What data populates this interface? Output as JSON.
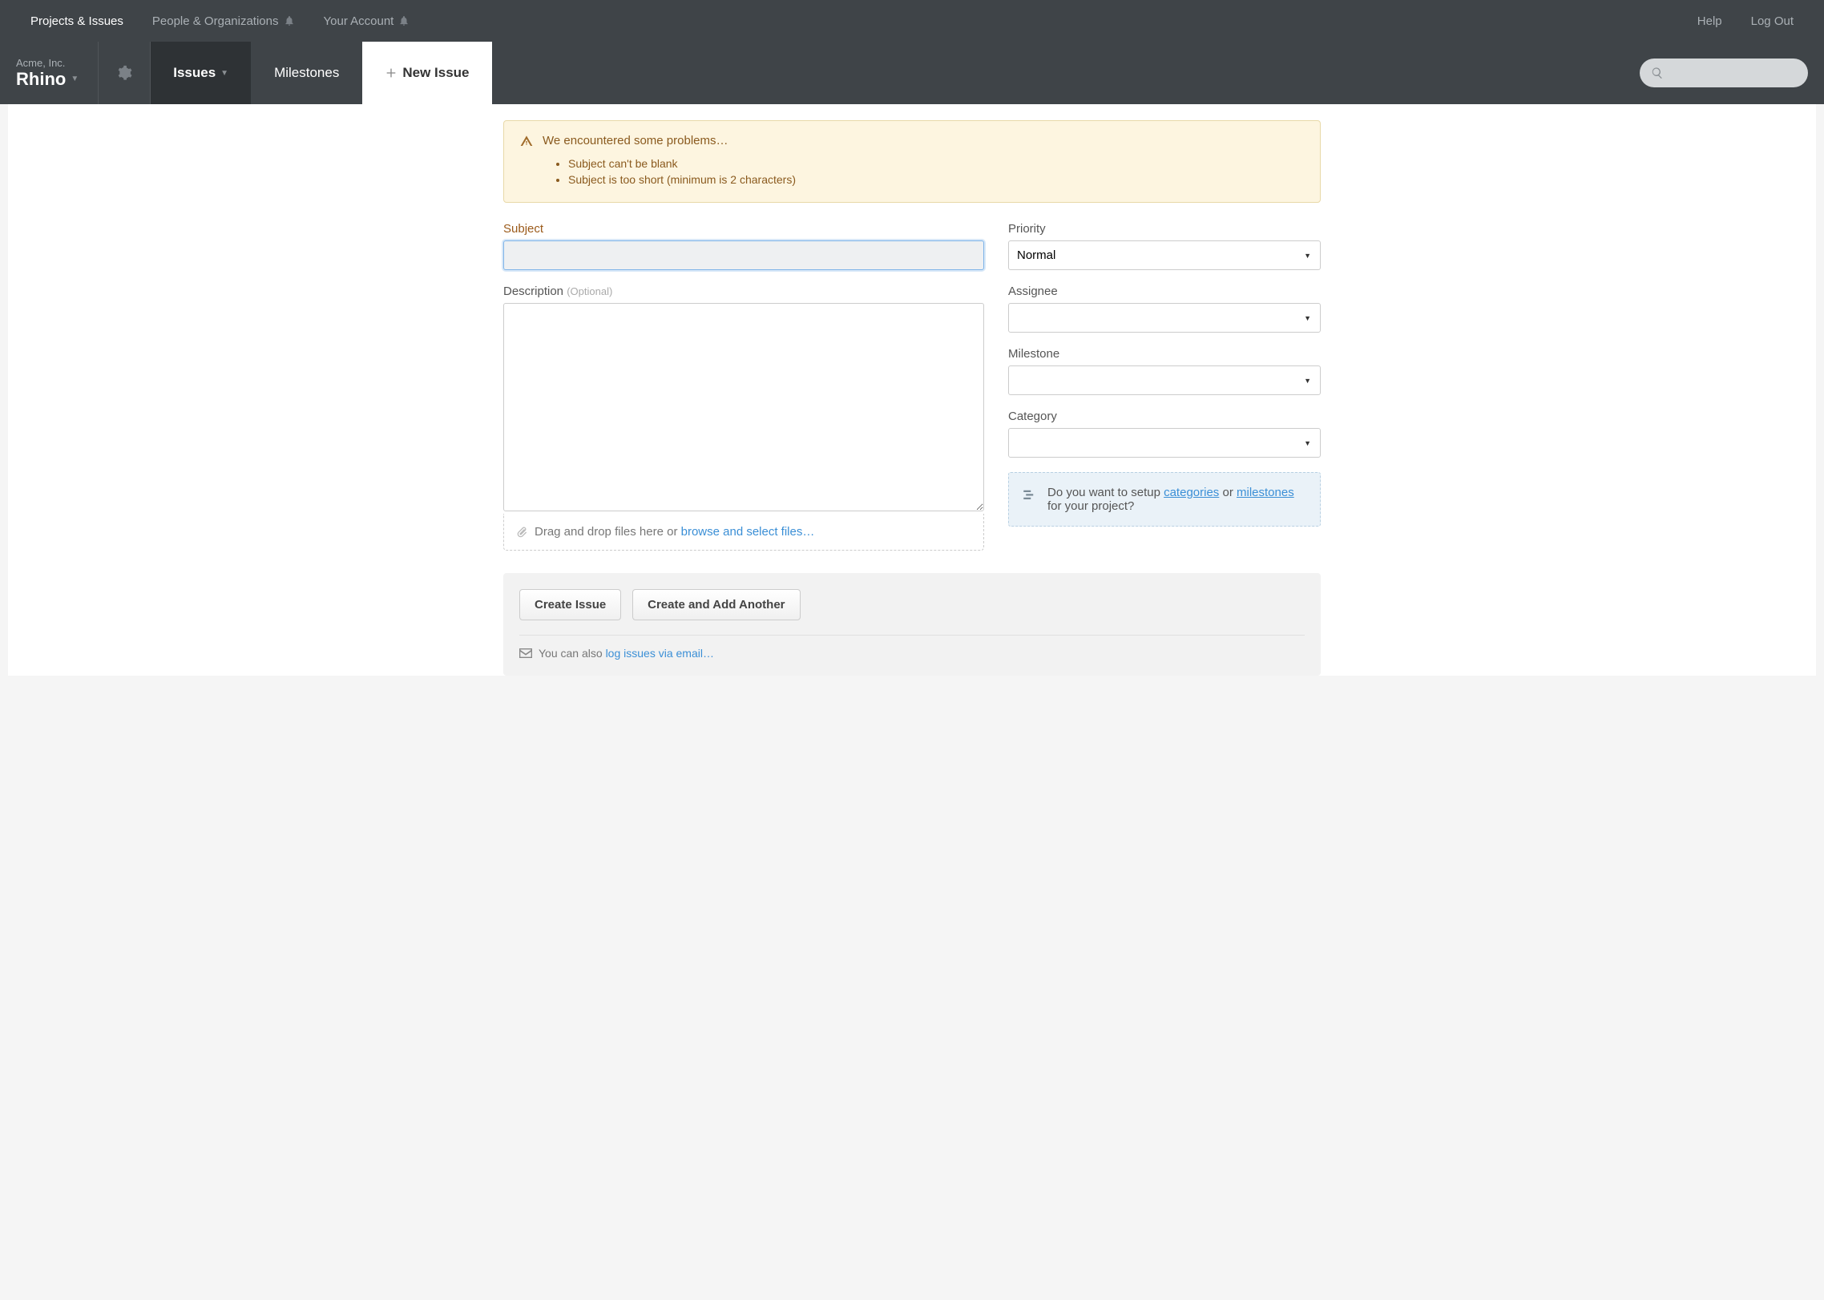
{
  "topnav": {
    "projects": "Projects & Issues",
    "people": "People & Organizations",
    "account": "Your Account",
    "help": "Help",
    "logout": "Log Out"
  },
  "subnav": {
    "org": "Acme, Inc.",
    "project": "Rhino",
    "issues": "Issues",
    "milestones": "Milestones",
    "newIssue": "New Issue"
  },
  "alert": {
    "title": "We encountered some problems…",
    "errors": [
      "Subject can't be blank",
      "Subject is too short (minimum is 2 characters)"
    ]
  },
  "form": {
    "subjectLabel": "Subject",
    "subjectValue": "",
    "descriptionLabel": "Description",
    "descriptionOptional": "(Optional)",
    "descriptionValue": "",
    "priorityLabel": "Priority",
    "priorityValue": "Normal",
    "assigneeLabel": "Assignee",
    "assigneeValue": "",
    "milestoneLabel": "Milestone",
    "milestoneValue": "",
    "categoryLabel": "Category",
    "categoryValue": ""
  },
  "dragzone": {
    "prefix": "Drag and drop files here or ",
    "link": "browse and select files…"
  },
  "infobox": {
    "prefix": "Do you want to setup ",
    "link1": "categories",
    "middle": " or ",
    "link2": "milestones",
    "suffix": " for your project?"
  },
  "actions": {
    "create": "Create Issue",
    "createAnother": "Create and Add Another",
    "notePrefix": "You can also ",
    "noteLink": "log issues via email…"
  }
}
